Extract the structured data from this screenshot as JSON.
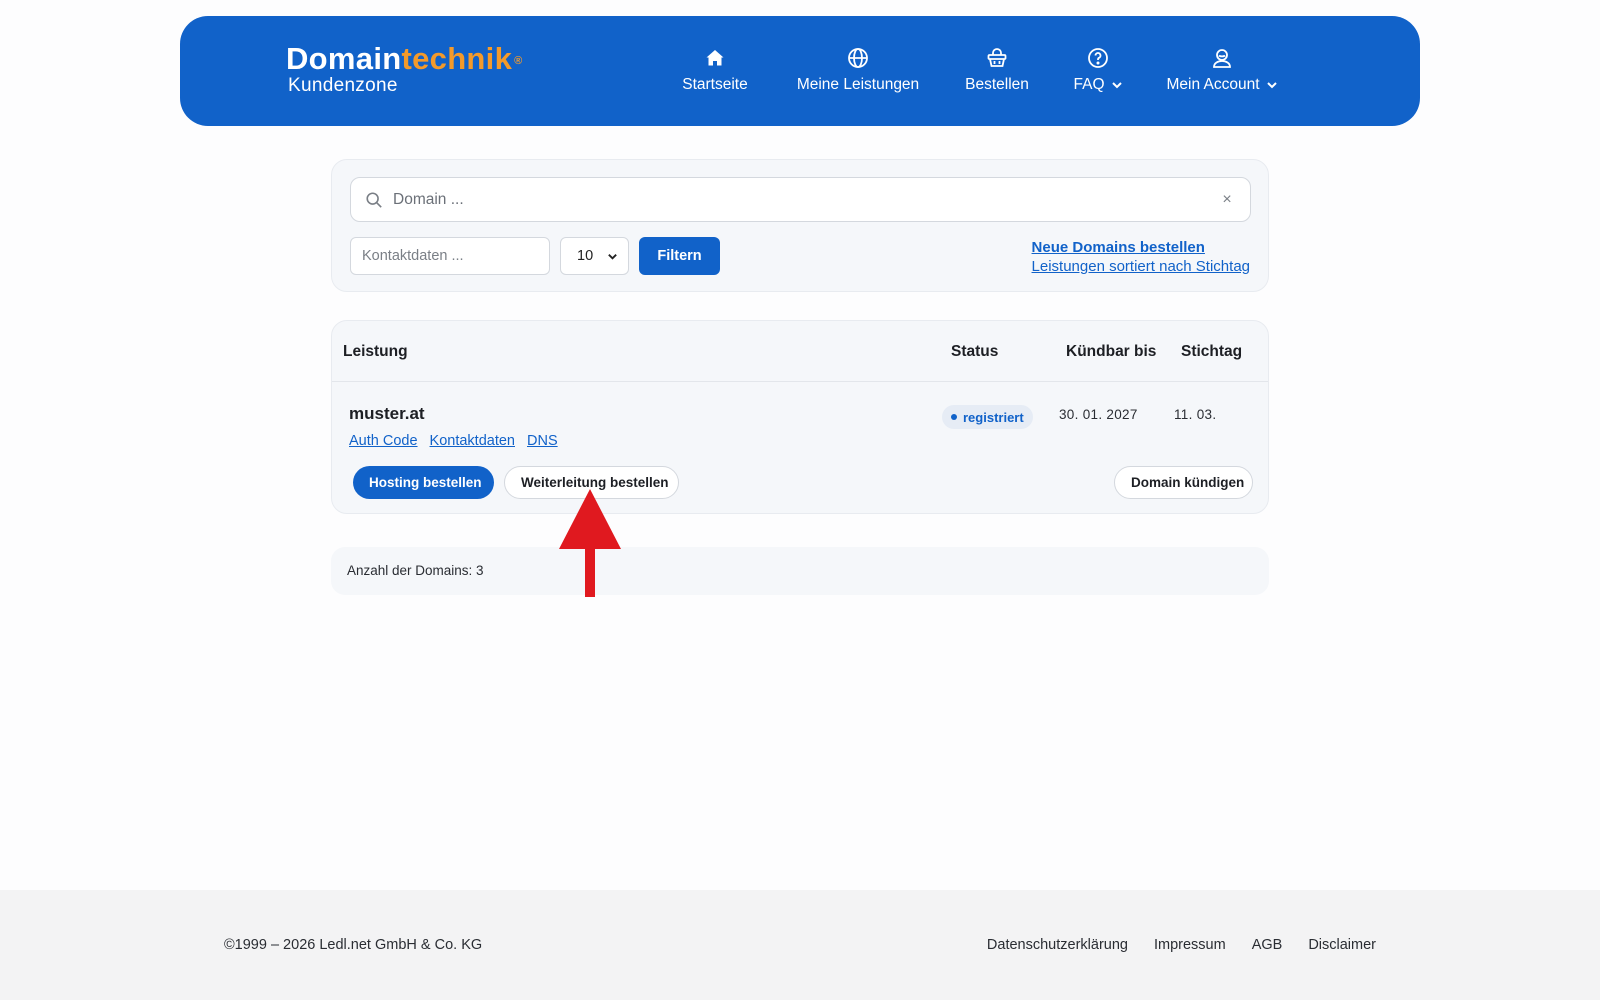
{
  "header": {
    "logo_part1": "Domain",
    "logo_part2": "technik",
    "logo_reg": "®",
    "logo_sub": "Kundenzone",
    "nav": [
      {
        "label": "Startseite",
        "icon": "home-icon"
      },
      {
        "label": "Meine Leistungen",
        "icon": "globe-icon"
      },
      {
        "label": "Bestellen",
        "icon": "basket-icon"
      },
      {
        "label": "FAQ",
        "icon": "question-icon",
        "dropdown": true
      },
      {
        "label": "Mein Account",
        "icon": "user-icon",
        "dropdown": true
      }
    ]
  },
  "filter": {
    "search_placeholder": "Domain ...",
    "clear": "×",
    "contact_placeholder": "Kontaktdaten ...",
    "count_value": "10",
    "filter_button": "Filtern",
    "link_new_domains": "Neue Domains bestellen",
    "link_sorted": "Leistungen sortiert nach Stichtag"
  },
  "table": {
    "headers": {
      "service": "Leistung",
      "status": "Status",
      "cancellable": "Kündbar bis",
      "deadline": "Stichtag"
    },
    "rows": [
      {
        "domain": "muster.at",
        "links": [
          "Auth Code",
          "Kontaktdaten",
          "DNS"
        ],
        "status": "registriert",
        "cancellable_until": "30. 01. 2027",
        "deadline": "11. 03.",
        "btn_hosting": "Hosting bestellen",
        "btn_forwarding": "Weiterleitung bestellen",
        "btn_cancel": "Domain kündigen"
      }
    ]
  },
  "count_text": "Anzahl der Domains: 3",
  "footer": {
    "copyright": "©1999 – 2026 Ledl.net GmbH & Co. KG",
    "links": [
      "Datenschutzerklärung",
      "Impressum",
      "AGB",
      "Disclaimer"
    ]
  },
  "colors": {
    "brand_blue": "#1162c9",
    "accent_orange": "#f39a2b",
    "annotation_red": "#e0191f"
  }
}
